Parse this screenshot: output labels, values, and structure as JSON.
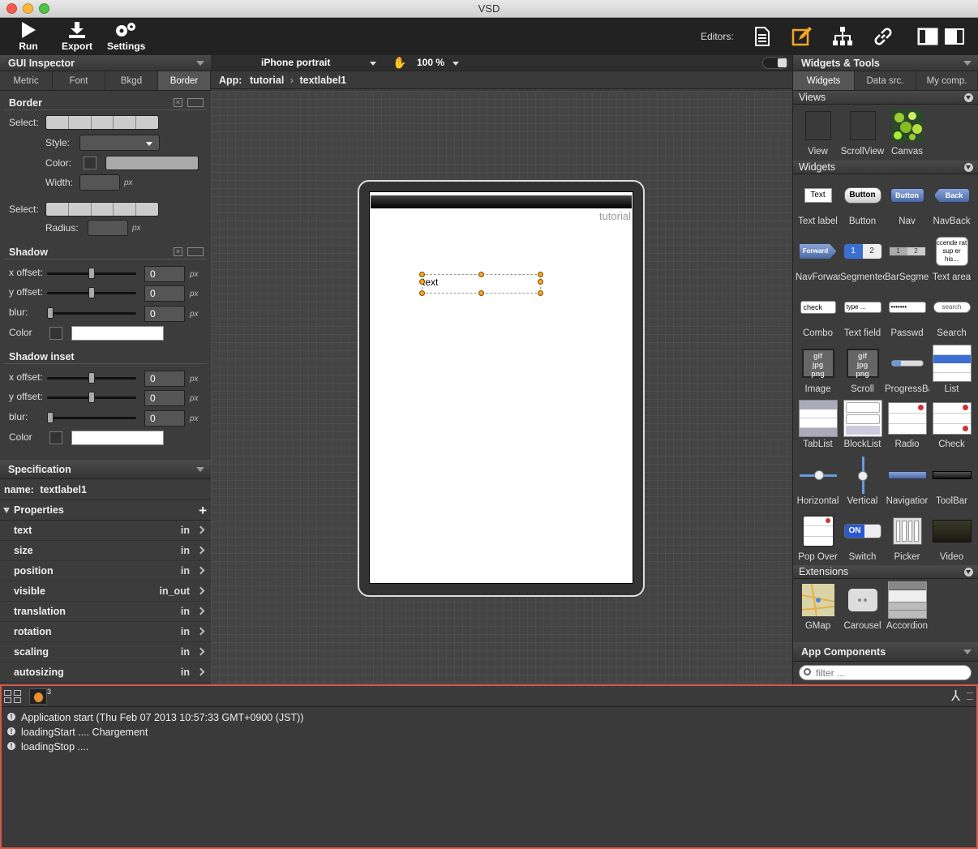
{
  "window": {
    "title": "VSD"
  },
  "toolbar": {
    "run": "Run",
    "export": "Export",
    "settings": "Settings",
    "editors_label": "Editors:"
  },
  "inspector": {
    "title": "GUI Inspector",
    "tabs": [
      "Metric",
      "Font",
      "Bkgd",
      "Border"
    ],
    "active_tab": "Border",
    "border": {
      "title": "Border",
      "select_label": "Select:",
      "style_label": "Style:",
      "color_label": "Color:",
      "width_label": "Width:",
      "select2_label": "Select:",
      "radius_label": "Radius:",
      "px": "px"
    },
    "shadow": {
      "title": "Shadow",
      "x_label": "x offset:",
      "y_label": "y offset:",
      "blur_label": "blur:",
      "color_label": "Color",
      "x": "0",
      "y": "0",
      "blur": "0"
    },
    "shadow_inset": {
      "title": "Shadow inset",
      "x_label": "x offset:",
      "y_label": "y offset:",
      "blur_label": "blur:",
      "color_label": "Color",
      "x": "0",
      "y": "0",
      "blur": "0"
    }
  },
  "specification": {
    "title": "Specification",
    "name_label": "name:",
    "name": "textlabel1",
    "properties_label": "Properties",
    "properties": [
      {
        "name": "text",
        "value": "in"
      },
      {
        "name": "size",
        "value": "in"
      },
      {
        "name": "position",
        "value": "in"
      },
      {
        "name": "visible",
        "value": "in_out"
      },
      {
        "name": "translation",
        "value": "in"
      },
      {
        "name": "rotation",
        "value": "in"
      },
      {
        "name": "scaling",
        "value": "in"
      },
      {
        "name": "autosizing",
        "value": "in"
      }
    ]
  },
  "center": {
    "device": "iPhone portrait",
    "zoom": "100 %",
    "crumb_app": "App:",
    "crumb_1": "tutorial",
    "crumb_2": "textlabel1",
    "screen_title": "tutorial",
    "label_text": "text"
  },
  "widgets_panel": {
    "title": "Widgets & Tools",
    "tabs": [
      "Widgets",
      "Data src.",
      "My comp."
    ],
    "views_label": "Views",
    "views": [
      "View",
      "ScrollView",
      "Canvas"
    ],
    "widgets_label": "Widgets",
    "widgets": [
      "Text label",
      "Button",
      "Nav",
      "NavBack",
      "NavForwar",
      "Segmentec",
      "BarSegmer",
      "Text area",
      "Combo",
      "Text field",
      "Passwd",
      "Search",
      "Image",
      "Scroll",
      "ProgressBa",
      "List",
      "TabList",
      "BlockList",
      "Radio",
      "Check",
      "Horizontal",
      "Vertical",
      "Navigatior",
      "ToolBar",
      "Pop Over",
      "Switch",
      "Picker",
      "Video"
    ],
    "icon_texts": {
      "text": "Text",
      "button": "Button",
      "nav": "Button",
      "back": "Back",
      "forward": "Forward",
      "seg1": "1",
      "seg2": "2",
      "textarea": "ccende rat sup er his...",
      "combo": "check",
      "textfield": "type ...",
      "passwd": "•••••••",
      "search": "search",
      "switch": "ON"
    },
    "extensions_label": "Extensions",
    "extensions": [
      "GMap",
      "Carousel",
      "Accordion"
    ],
    "app_components_label": "App Components",
    "filter_placeholder": "filter ..."
  },
  "console": {
    "badge": "3",
    "logs": [
      "Application start (Thu Feb 07 2013 10:57:33 GMT+0900 (JST))",
      "loadingStart .... Chargement",
      "loadingStop ...."
    ]
  },
  "colors": {
    "accent": "#f5a623",
    "console_border": "#d6584a"
  }
}
